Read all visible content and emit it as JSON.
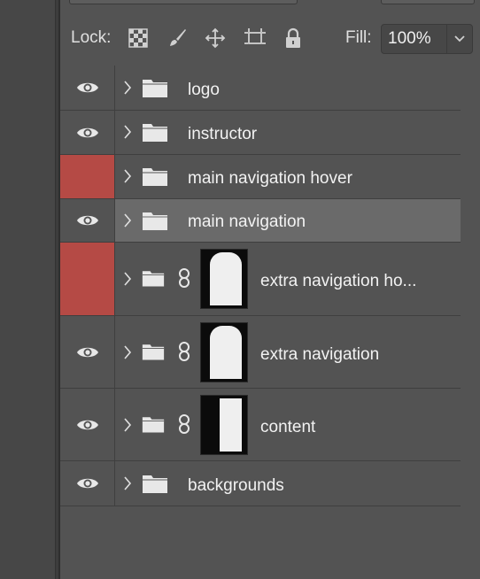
{
  "lockbar": {
    "lock_label": "Lock:",
    "fill_label": "Fill:",
    "fill_value": "100%"
  },
  "lock_icons": [
    "lock-transparent-pixels-icon",
    "lock-image-pixels-icon",
    "lock-position-icon",
    "lock-artboard-icon",
    "lock-all-icon"
  ],
  "colors": {
    "panel": "#535353",
    "selected_row": "#6a6a6a",
    "hidden_visibility": "#b54a45"
  },
  "layers": [
    {
      "name": "logo",
      "visible": true,
      "has_mask": false
    },
    {
      "name": "instructor",
      "visible": true,
      "has_mask": false
    },
    {
      "name": "main navigation hover",
      "visible": false,
      "has_mask": false
    },
    {
      "name": "main navigation",
      "visible": true,
      "selected": true,
      "has_mask": false
    },
    {
      "name": "extra navigation ho...",
      "visible": false,
      "has_mask": true
    },
    {
      "name": "extra navigation",
      "visible": true,
      "has_mask": true
    },
    {
      "name": "content",
      "visible": true,
      "has_mask": true
    },
    {
      "name": "backgrounds",
      "visible": true,
      "has_mask": false
    }
  ]
}
